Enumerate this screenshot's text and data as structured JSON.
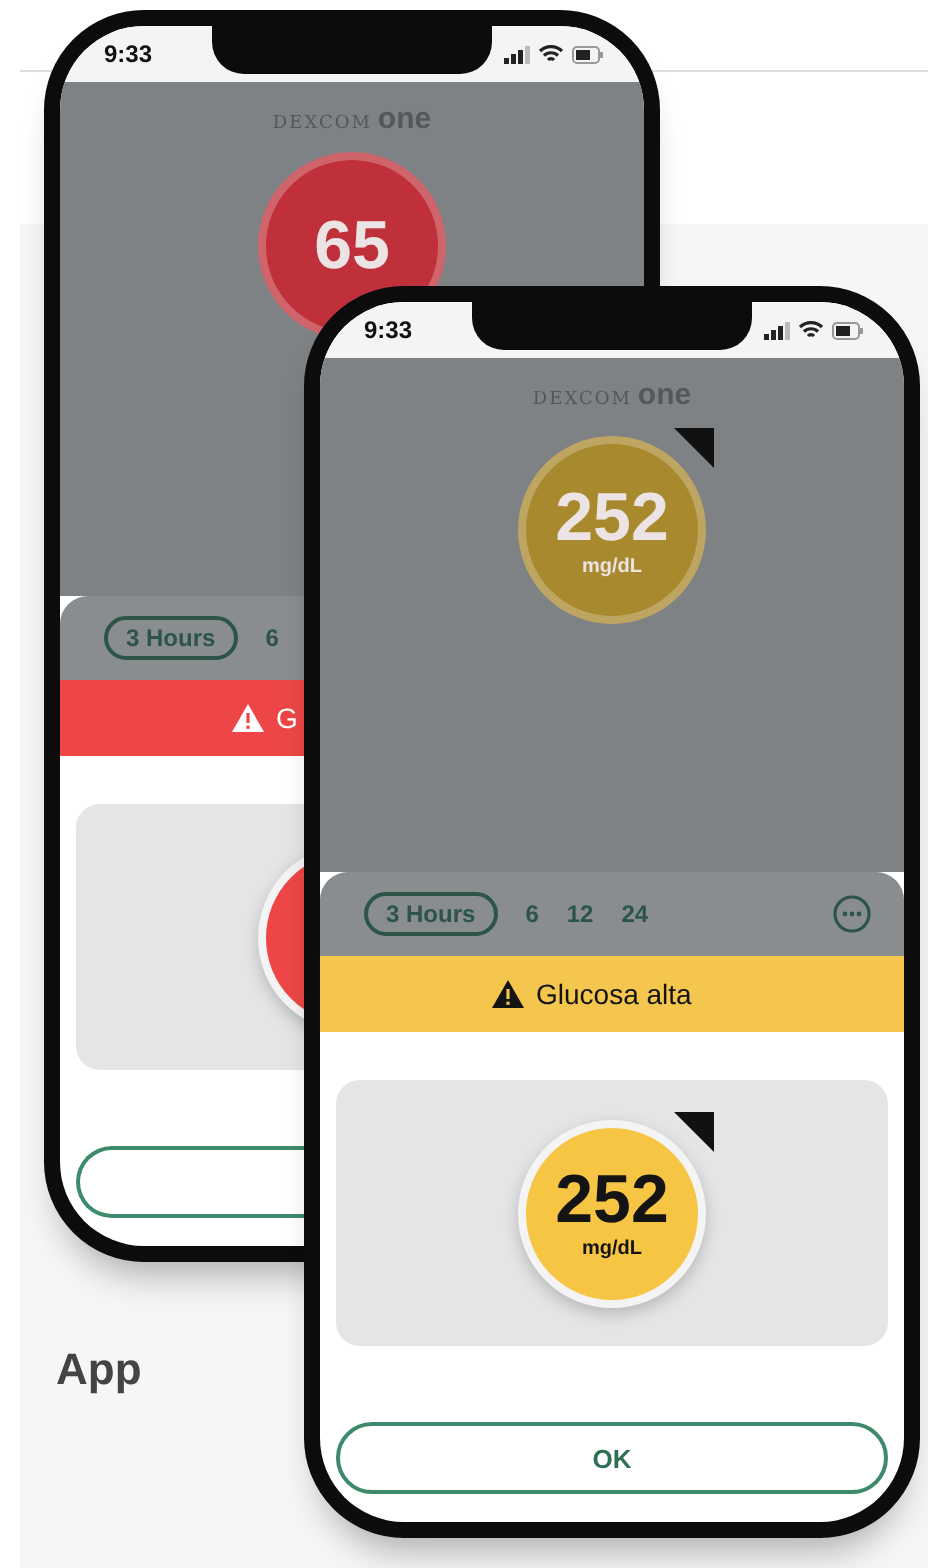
{
  "section": {
    "heading": "App"
  },
  "phones": [
    {
      "status_time": "9:33",
      "logo": {
        "brand": "DEXCOM",
        "product": "one"
      },
      "reading": {
        "value": "65",
        "color": "#c0303a"
      },
      "ranges": [
        {
          "label": "3 Hours",
          "selected": true
        },
        {
          "label": "6",
          "selected": false
        }
      ],
      "alert": {
        "text": "G",
        "color": "#ee4646"
      },
      "card_reading": {
        "color": "#ee4646"
      }
    },
    {
      "status_time": "9:33",
      "logo": {
        "brand": "DEXCOM",
        "product": "one"
      },
      "reading": {
        "value": "252",
        "unit": "mg/dL",
        "color": "#a8892e",
        "trend": true
      },
      "ranges": [
        {
          "label": "3 Hours",
          "selected": true
        },
        {
          "label": "6",
          "selected": false
        },
        {
          "label": "12",
          "selected": false
        },
        {
          "label": "24",
          "selected": false
        }
      ],
      "alert": {
        "text": "Glucosa alta",
        "color": "#f4c64e"
      },
      "card_reading": {
        "value": "252",
        "unit": "mg/dL",
        "color": "#f6c543",
        "trend": true
      },
      "button_label": "OK"
    }
  ]
}
